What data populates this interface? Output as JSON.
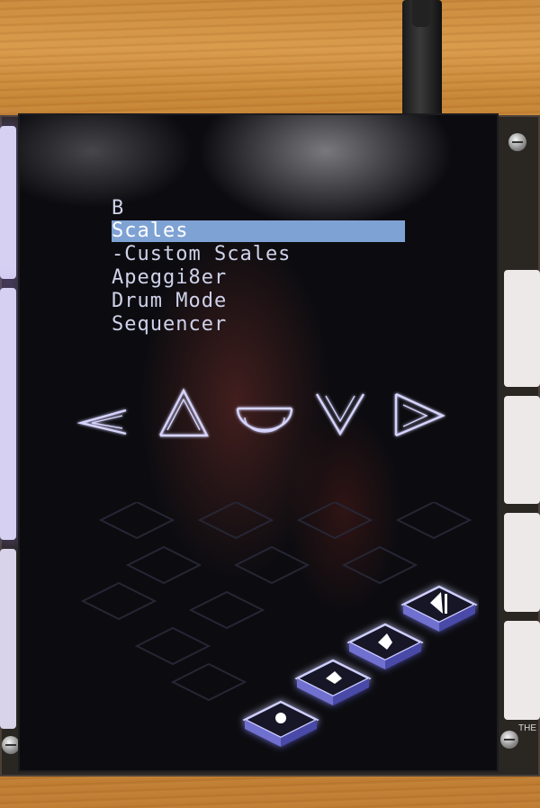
{
  "menu": {
    "items": [
      {
        "label": "B",
        "selected": false
      },
      {
        "label": "Scales",
        "selected": true
      },
      {
        "label": "-Custom Scales",
        "selected": false
      },
      {
        "label": "Apeggi8er",
        "selected": false
      },
      {
        "label": "Drum Mode",
        "selected": false
      },
      {
        "label": "Sequencer",
        "selected": false
      }
    ]
  },
  "nav_arrows": [
    "left-arrow-icon",
    "up-arrow-icon",
    "circle-icon",
    "down-arrow-icon",
    "right-arrow-icon"
  ],
  "pads": {
    "lit": [
      "pad-1-icon",
      "pad-2-icon",
      "pad-3-icon",
      "pad-4-icon"
    ],
    "colors": {
      "lit": "#ffffff",
      "glow": "#8f8cff",
      "dim": "#2a2a3a"
    }
  },
  "case_label": "THE"
}
